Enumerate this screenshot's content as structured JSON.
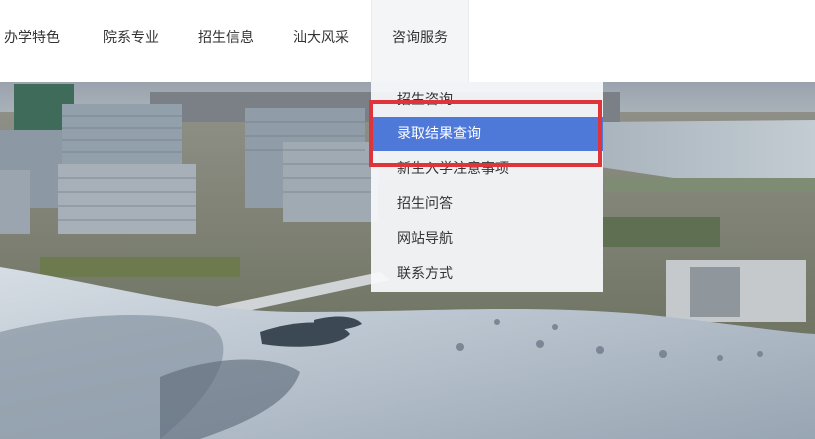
{
  "nav": {
    "items": [
      "办学特色",
      "院系专业",
      "招生信息",
      "汕大风采",
      "咨询服务"
    ],
    "active_index": 4
  },
  "dropdown": {
    "items": [
      "招生咨询",
      "录取结果查询",
      "新生入学注意事项",
      "招生问答",
      "网站导航",
      "联系方式"
    ],
    "selected_index": 1
  },
  "colors": {
    "highlight_border": "#e0343b",
    "selected_bg": "#4f79d9",
    "nav_text": "#333333"
  }
}
